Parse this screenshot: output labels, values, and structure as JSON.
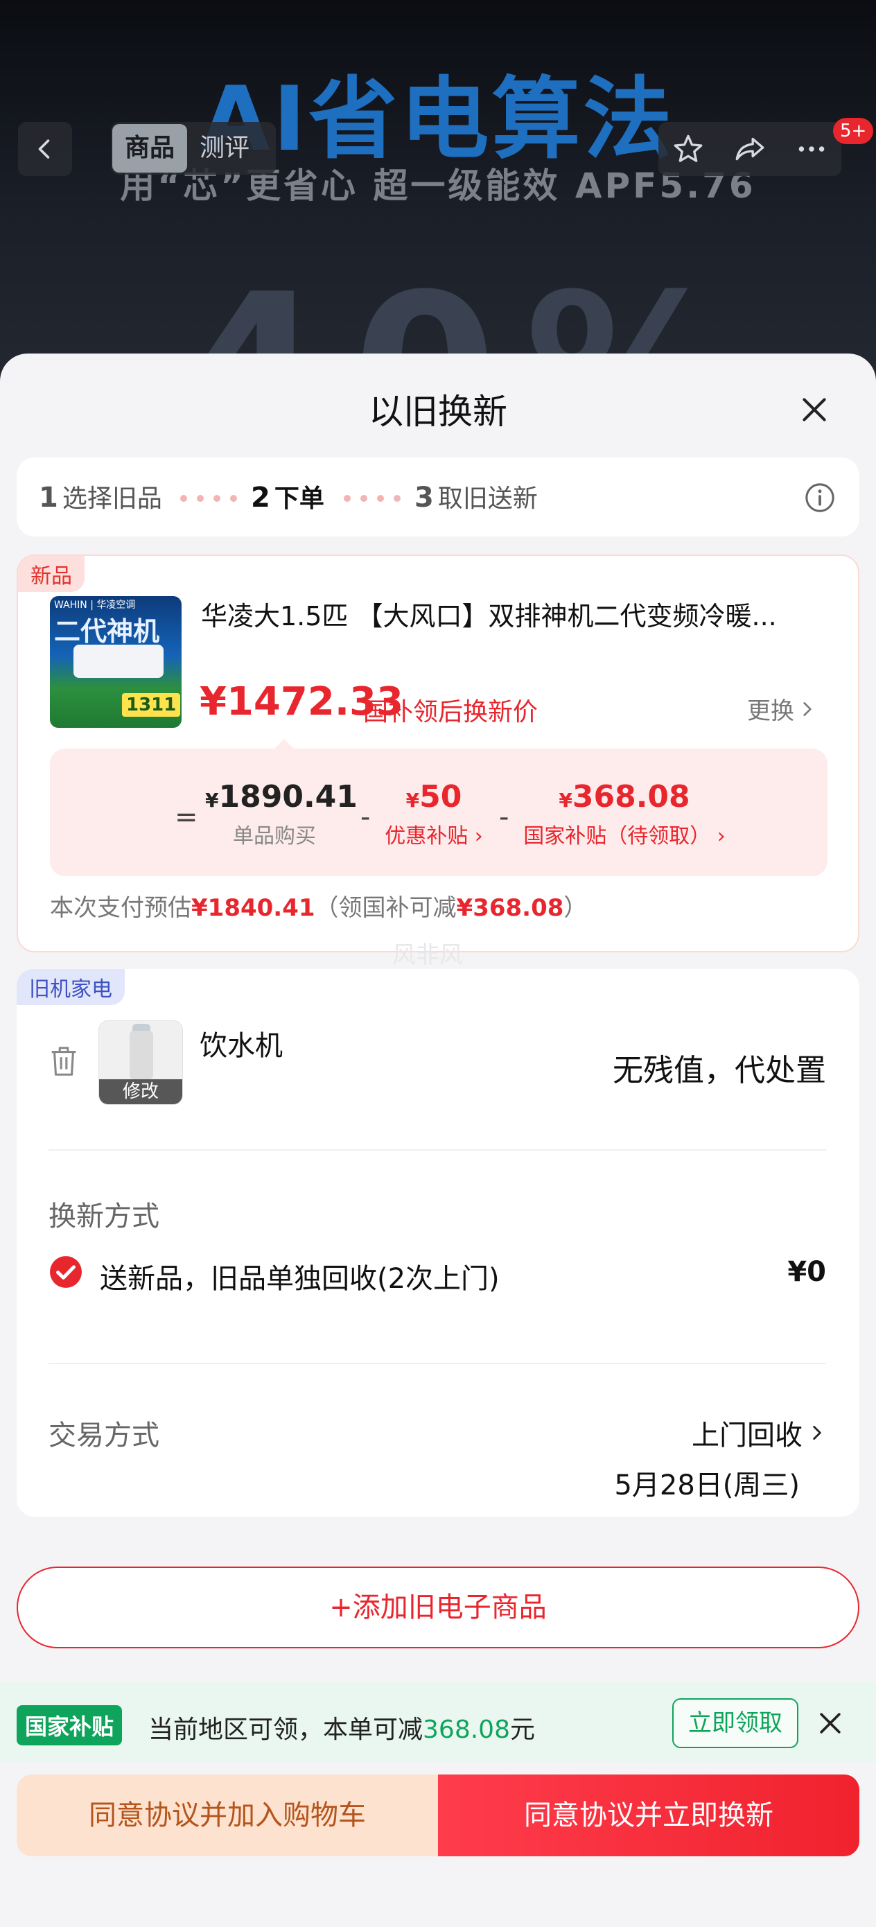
{
  "hero": {
    "title": "AI省电算法",
    "subtitle": "用“芯”更省心 超一级能效 APF5.76",
    "big_text": "40%"
  },
  "nav": {
    "tabs": [
      "商品",
      "测评"
    ],
    "active_tab": "商品",
    "badge": "5+"
  },
  "sheet": {
    "title": "以旧换新",
    "steps": [
      {
        "num": "1",
        "label": "选择旧品"
      },
      {
        "num": "2",
        "label": "下单"
      },
      {
        "num": "3",
        "label": "取旧送新"
      }
    ]
  },
  "new_product": {
    "tag": "新品",
    "image_brand": "WAHIN | 华凌空调",
    "image_text": "二代神机",
    "image_price": "1311",
    "title": "华凌大1.5匹 【大风口】双排神机二代变频冷暖...",
    "price": "¥1472.33",
    "price_label": "国补领后换新价",
    "change_label": "更换",
    "breakdown": {
      "eq": "=",
      "base_symbol": "¥",
      "base_value": "1890.41",
      "base_label": "单品购买",
      "minus": "-",
      "discount_symbol": "¥",
      "discount_value": "50",
      "discount_label": "优惠补贴 ›",
      "subsidy_symbol": "¥",
      "subsidy_value": "368.08",
      "subsidy_label": "国家补贴（待领取） ›"
    },
    "pay_prefix": "本次支付预估",
    "pay_amount": "¥1840.41",
    "pay_mid": "（领国补可减",
    "pay_subsidy": "¥368.08",
    "pay_suffix": "）",
    "watermark": "风非风"
  },
  "old_product": {
    "tag": "旧机家电",
    "name": "饮水机",
    "edit_label": "修改",
    "value": "无残值，代处置",
    "method_section": "换新方式",
    "method_text": "送新品，旧品单独回收(2次上门)",
    "method_price": "¥0",
    "trade_section": "交易方式",
    "trade_value": "上门回收",
    "trade_date": "5月28日(周三)"
  },
  "add_button": "+添加旧电子商品",
  "subsidy_bar": {
    "tag": "国家补贴",
    "text_prefix": "当前地区可领，本单可减",
    "amount": "368.08",
    "text_suffix": "元",
    "button": "立即领取"
  },
  "actions": {
    "cart": "同意协议并加入购物车",
    "buy": "同意协议并立即换新"
  },
  "colors": {
    "accent_red": "#e8262e",
    "subsidy_green": "#0fa45c",
    "cart_bg": "#fde3cf"
  }
}
